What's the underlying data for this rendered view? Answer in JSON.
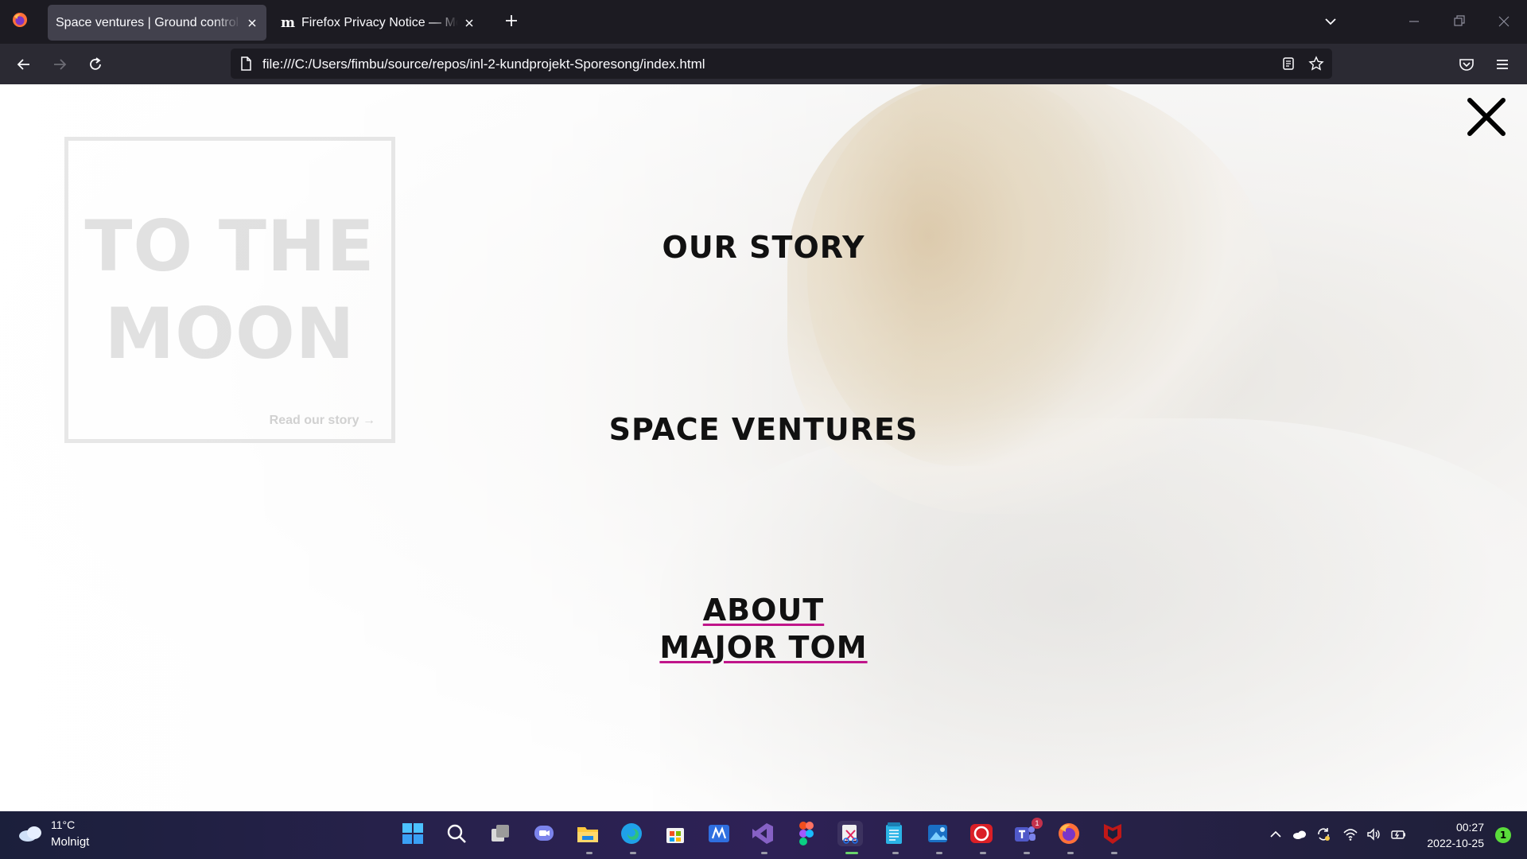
{
  "browser": {
    "tabs": [
      {
        "title": "Space ventures | Ground control to Major Tom",
        "active": true
      },
      {
        "title": "Firefox Privacy Notice — Mozilla",
        "active": false,
        "favicon_text": "m"
      }
    ],
    "url": "file:///C:/Users/fimbu/source/repos/inl-2-kundprojekt-Sporesong/index.html"
  },
  "page": {
    "hero": {
      "title_line1": "TO THE",
      "title_line2": "MOON",
      "link": "Read our story →"
    },
    "menu": {
      "items": [
        {
          "label": "OUR STORY"
        },
        {
          "label": "SPACE VENTURES"
        },
        {
          "label_line1": "ABOUT",
          "label_line2": "MAJOR TOM"
        }
      ]
    }
  },
  "taskbar": {
    "weather": {
      "temp": "11°C",
      "condition": "Molnigt"
    },
    "clock": {
      "time": "00:27",
      "date": "2022-10-25"
    },
    "notification_count": "1",
    "teams_badge": "1",
    "apps": [
      "start-icon",
      "search-icon",
      "task-view-icon",
      "chat-icon",
      "file-explorer-icon",
      "edge-icon",
      "store-icon",
      "visual-studio-code-icon",
      "visual-studio-icon",
      "figma-icon",
      "snipping-tool-icon",
      "notepad-icon",
      "photos-icon",
      "creative-cloud-icon",
      "teams-icon",
      "firefox-icon",
      "mcafee-icon"
    ]
  },
  "colors": {
    "accent_underline": "#c0158a",
    "tab_active": "#42414d",
    "toolbar": "#2b2a33",
    "titlebar": "#1c1b22"
  }
}
